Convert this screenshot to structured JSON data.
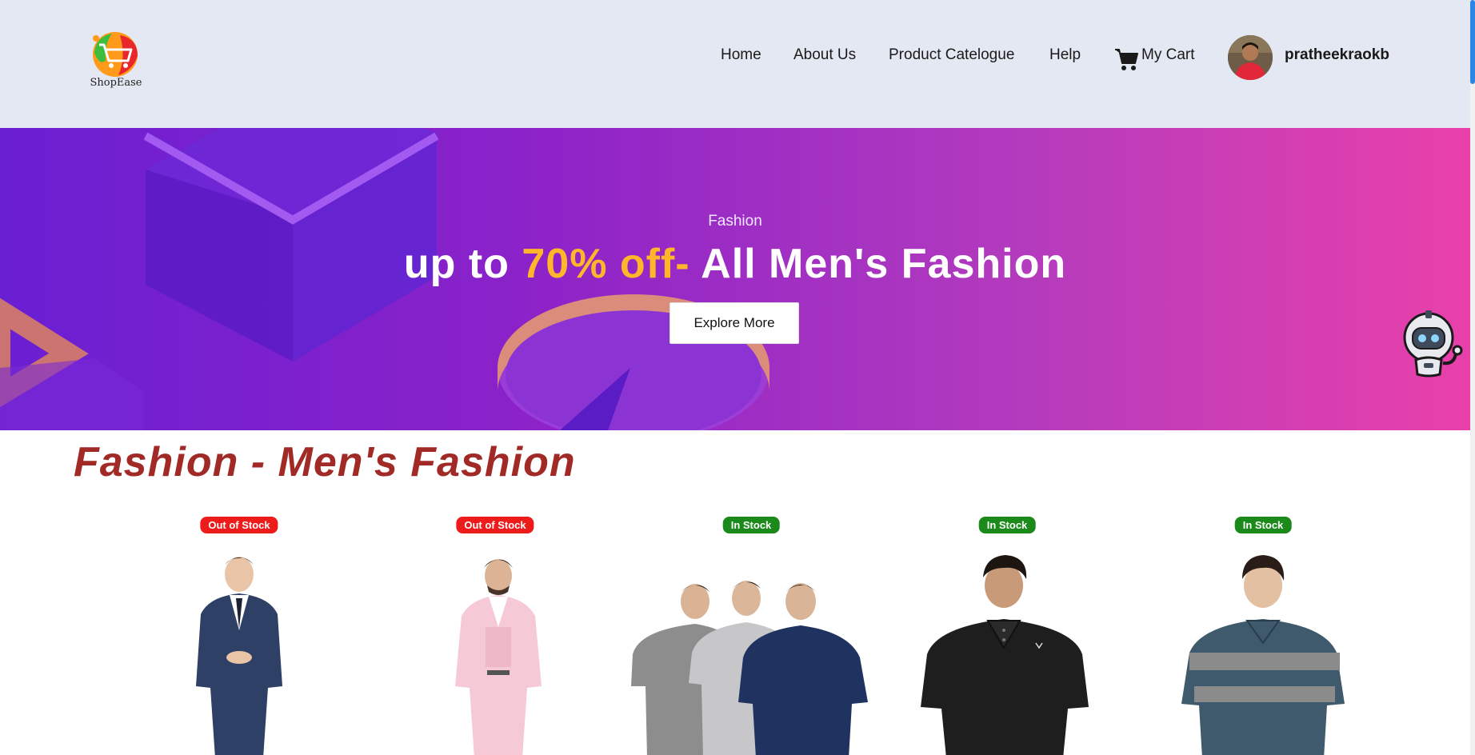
{
  "header": {
    "logo_text": "ShopEase",
    "nav": [
      {
        "label": "Home"
      },
      {
        "label": "About Us"
      },
      {
        "label": "Product Catelogue"
      },
      {
        "label": "Help"
      }
    ],
    "cart_label": "My Cart",
    "username": "pratheekraokb"
  },
  "hero": {
    "category": "Fashion",
    "title_prefix": "up to ",
    "title_highlight": "70% off-",
    "title_suffix": " All Men's Fashion",
    "button_label": "Explore More"
  },
  "section": {
    "title": "Fashion - Men's Fashion",
    "products": [
      {
        "stock": "Out of Stock",
        "in_stock": false,
        "kind": "navy-suit"
      },
      {
        "stock": "Out of Stock",
        "in_stock": false,
        "kind": "pink-suit"
      },
      {
        "stock": "In Stock",
        "in_stock": true,
        "kind": "tshirt-pack"
      },
      {
        "stock": "In Stock",
        "in_stock": true,
        "kind": "black-polo"
      },
      {
        "stock": "In Stock",
        "in_stock": true,
        "kind": "striped-polo"
      }
    ]
  },
  "colors": {
    "header_bg": "#e3e8f2",
    "hero_start": "#6a1fd2",
    "hero_end": "#e940aa",
    "highlight": "#ffb62a",
    "section_title": "#a12a26",
    "out_of_stock": "#ee1b1b",
    "in_stock": "#1b8a1b"
  }
}
